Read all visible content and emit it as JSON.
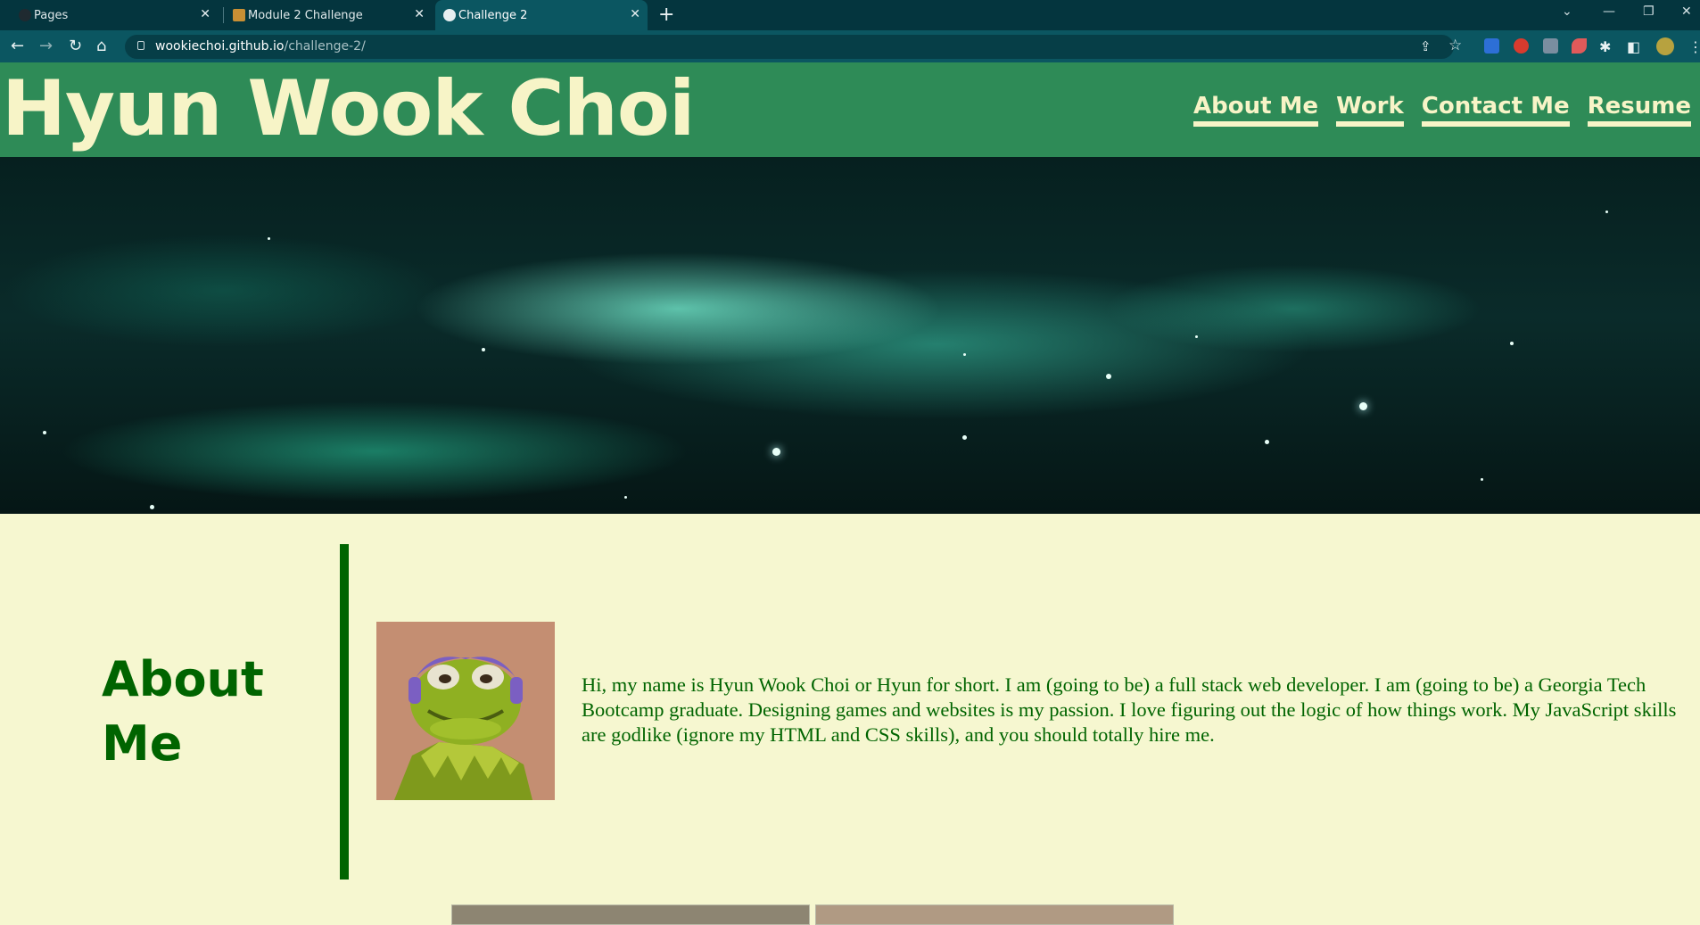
{
  "browser": {
    "tabs": [
      {
        "label": "Pages",
        "active": false
      },
      {
        "label": "Module 2 Challenge",
        "active": false
      },
      {
        "label": "Challenge 2",
        "active": true
      }
    ],
    "url_host": "wookiechoi.github.io",
    "url_path": "/challenge-2/",
    "new_tab_glyph": "+",
    "close_glyph": "✕",
    "back_glyph": "←",
    "forward_glyph": "→",
    "reload_glyph": "↻",
    "home_glyph": "⌂",
    "minimize_glyph": "—",
    "restore_glyph": "❐",
    "close_window_glyph": "✕",
    "tabsearch_glyph": "⌄",
    "menu_glyph": "⋮",
    "share_glyph": "⇪",
    "star_glyph": "☆",
    "extensions_glyph": "✱",
    "sidepanel_glyph": "◧"
  },
  "site": {
    "title": "Hyun Wook Choi",
    "nav": [
      "About Me",
      "Work",
      "Contact Me",
      "Resume"
    ],
    "colors": {
      "header": "#2e8b57",
      "header_text": "#f7f4c7",
      "accent": "#006400",
      "background": "#f6f7d0"
    }
  },
  "about": {
    "heading_line1": "About",
    "heading_line2": "Me",
    "text": "Hi, my name is Hyun Wook Choi or Hyun for short. I am (going to be) a full stack web developer. I am (going to be) a Georgia Tech Bootcamp graduate. Designing games and websites is my passion. I love figuring out the logic of how things work. My JavaScript skills are godlike (ignore my HTML and CSS skills), and you should totally hire me."
  }
}
